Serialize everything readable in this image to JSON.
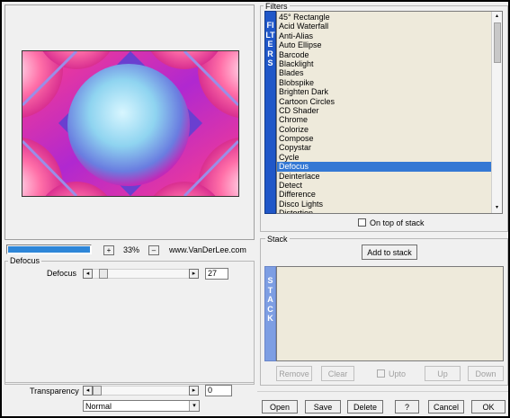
{
  "preview": {
    "zoom_label": "33%",
    "website": "www.VanDerLee.com",
    "plus": "+",
    "minus": "–"
  },
  "defocus_group": {
    "title": "Defocus",
    "param_label": "Defocus",
    "param_value": "27",
    "transparency_label": "Transparency",
    "transparency_value": "0",
    "blend_mode": "Normal"
  },
  "filters": {
    "group_title": "Filters",
    "sidebar_text": "FILTERS",
    "items": [
      "45° Rectangle",
      "Acid Waterfall",
      "Anti-Alias",
      "Auto Ellipse",
      "Barcode",
      "Blacklight",
      "Blades",
      "Blobspike",
      "Brighten Dark",
      "Cartoon Circles",
      "CD Shader",
      "Chrome",
      "Colorize",
      "Compose",
      "Copystar",
      "Cycle",
      "Defocus",
      "Deinterlace",
      "Detect",
      "Difference",
      "Disco Lights",
      "Distortion"
    ],
    "selected_index": 16,
    "on_top_label": "On top of stack"
  },
  "stack": {
    "group_title": "Stack",
    "add_label": "Add to stack",
    "sidebar_text": "STACK",
    "remove_label": "Remove",
    "clear_label": "Clear",
    "upto_label": "Upto",
    "up_label": "Up",
    "down_label": "Down"
  },
  "footer": {
    "open": "Open",
    "save": "Save",
    "delete": "Delete",
    "help": "?",
    "cancel": "Cancel",
    "ok": "OK"
  }
}
